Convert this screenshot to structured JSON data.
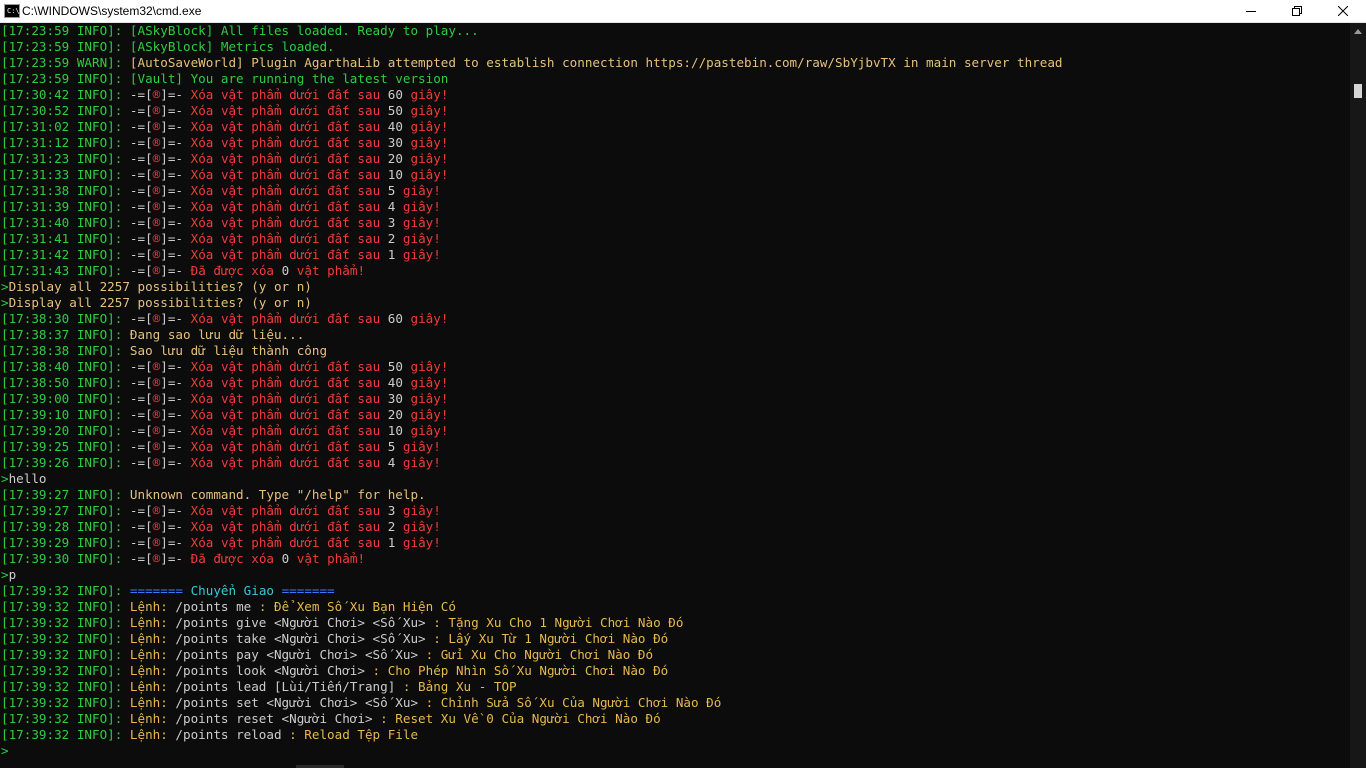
{
  "window": {
    "title": "C:\\WINDOWS\\system32\\cmd.exe",
    "icon": "cmd-icon",
    "icon_text": "C:\\",
    "controls": [
      "minimize-icon",
      "restore-icon",
      "close-icon"
    ]
  },
  "colors": {
    "timestamp": "#2ecc40",
    "message_green": "#2ecc40",
    "message_red": "#ef3b3b",
    "message_white": "#cccccc",
    "message_yellow": "#e5c07b",
    "message_cyan": "#3bc7d6",
    "background": "#0c0c0c"
  },
  "console": {
    "lines": [
      {
        "ts": "[17:23:59 INFO]:",
        "parts": [
          {
            "t": " [ASkyBlock] All files loaded. Ready to play...",
            "c": "green"
          }
        ]
      },
      {
        "ts": "[17:23:59 INFO]:",
        "parts": [
          {
            "t": " [ASkyBlock] Metrics loaded.",
            "c": "green"
          }
        ]
      },
      {
        "ts": "[17:23:59 WARN]:",
        "parts": [
          {
            "t": " [AutoSaveWorld] Plugin AgarthaLib attempted to establish connection https://pastebin.com/raw/SbYjbvTX in main server thread",
            "c": "yellow"
          }
        ]
      },
      {
        "ts": "[17:23:59 INFO]:",
        "parts": [
          {
            "t": " [Vault] You are running the latest version",
            "c": "green"
          }
        ]
      },
      {
        "ts": "[17:30:42 INFO]:",
        "parts": [
          {
            "t": " -=[",
            "c": "white"
          },
          {
            "t": "®",
            "c": "red"
          },
          {
            "t": "]=- ",
            "c": "white"
          },
          {
            "t": "Xóa vật phẩm dưới đất sau ",
            "c": "red"
          },
          {
            "t": "60",
            "c": "white"
          },
          {
            "t": " giây!",
            "c": "red"
          }
        ]
      },
      {
        "ts": "[17:30:52 INFO]:",
        "parts": [
          {
            "t": " -=[",
            "c": "white"
          },
          {
            "t": "®",
            "c": "red"
          },
          {
            "t": "]=- ",
            "c": "white"
          },
          {
            "t": "Xóa vật phẩm dưới đất sau ",
            "c": "red"
          },
          {
            "t": "50",
            "c": "white"
          },
          {
            "t": " giây!",
            "c": "red"
          }
        ]
      },
      {
        "ts": "[17:31:02 INFO]:",
        "parts": [
          {
            "t": " -=[",
            "c": "white"
          },
          {
            "t": "®",
            "c": "red"
          },
          {
            "t": "]=- ",
            "c": "white"
          },
          {
            "t": "Xóa vật phẩm dưới đất sau ",
            "c": "red"
          },
          {
            "t": "40",
            "c": "white"
          },
          {
            "t": " giây!",
            "c": "red"
          }
        ]
      },
      {
        "ts": "[17:31:12 INFO]:",
        "parts": [
          {
            "t": " -=[",
            "c": "white"
          },
          {
            "t": "®",
            "c": "red"
          },
          {
            "t": "]=- ",
            "c": "white"
          },
          {
            "t": "Xóa vật phẩm dưới đất sau ",
            "c": "red"
          },
          {
            "t": "30",
            "c": "white"
          },
          {
            "t": " giây!",
            "c": "red"
          }
        ]
      },
      {
        "ts": "[17:31:23 INFO]:",
        "parts": [
          {
            "t": " -=[",
            "c": "white"
          },
          {
            "t": "®",
            "c": "red"
          },
          {
            "t": "]=- ",
            "c": "white"
          },
          {
            "t": "Xóa vật phẩm dưới đất sau ",
            "c": "red"
          },
          {
            "t": "20",
            "c": "white"
          },
          {
            "t": " giây!",
            "c": "red"
          }
        ]
      },
      {
        "ts": "[17:31:33 INFO]:",
        "parts": [
          {
            "t": " -=[",
            "c": "white"
          },
          {
            "t": "®",
            "c": "red"
          },
          {
            "t": "]=- ",
            "c": "white"
          },
          {
            "t": "Xóa vật phẩm dưới đất sau ",
            "c": "red"
          },
          {
            "t": "10",
            "c": "white"
          },
          {
            "t": " giây!",
            "c": "red"
          }
        ]
      },
      {
        "ts": "[17:31:38 INFO]:",
        "parts": [
          {
            "t": " -=[",
            "c": "white"
          },
          {
            "t": "®",
            "c": "red"
          },
          {
            "t": "]=- ",
            "c": "white"
          },
          {
            "t": "Xóa vật phẩm dưới đất sau ",
            "c": "red"
          },
          {
            "t": "5",
            "c": "white"
          },
          {
            "t": " giây!",
            "c": "red"
          }
        ]
      },
      {
        "ts": "[17:31:39 INFO]:",
        "parts": [
          {
            "t": " -=[",
            "c": "white"
          },
          {
            "t": "®",
            "c": "red"
          },
          {
            "t": "]=- ",
            "c": "white"
          },
          {
            "t": "Xóa vật phẩm dưới đất sau ",
            "c": "red"
          },
          {
            "t": "4",
            "c": "white"
          },
          {
            "t": " giây!",
            "c": "red"
          }
        ]
      },
      {
        "ts": "[17:31:40 INFO]:",
        "parts": [
          {
            "t": " -=[",
            "c": "white"
          },
          {
            "t": "®",
            "c": "red"
          },
          {
            "t": "]=- ",
            "c": "white"
          },
          {
            "t": "Xóa vật phẩm dưới đất sau ",
            "c": "red"
          },
          {
            "t": "3",
            "c": "white"
          },
          {
            "t": " giây!",
            "c": "red"
          }
        ]
      },
      {
        "ts": "[17:31:41 INFO]:",
        "parts": [
          {
            "t": " -=[",
            "c": "white"
          },
          {
            "t": "®",
            "c": "red"
          },
          {
            "t": "]=- ",
            "c": "white"
          },
          {
            "t": "Xóa vật phẩm dưới đất sau ",
            "c": "red"
          },
          {
            "t": "2",
            "c": "white"
          },
          {
            "t": " giây!",
            "c": "red"
          }
        ]
      },
      {
        "ts": "[17:31:42 INFO]:",
        "parts": [
          {
            "t": " -=[",
            "c": "white"
          },
          {
            "t": "®",
            "c": "red"
          },
          {
            "t": "]=- ",
            "c": "white"
          },
          {
            "t": "Xóa vật phẩm dưới đất sau ",
            "c": "red"
          },
          {
            "t": "1",
            "c": "white"
          },
          {
            "t": " giây!",
            "c": "red"
          }
        ]
      },
      {
        "ts": "[17:31:43 INFO]:",
        "parts": [
          {
            "t": " -=[",
            "c": "white"
          },
          {
            "t": "®",
            "c": "red"
          },
          {
            "t": "]=- ",
            "c": "white"
          },
          {
            "t": "Đã được xóa ",
            "c": "red"
          },
          {
            "t": "0",
            "c": "white"
          },
          {
            "t": " vật phẩm!",
            "c": "red"
          }
        ]
      },
      {
        "ts": "",
        "parts": [
          {
            "t": ">",
            "c": "green"
          },
          {
            "t": "Display all 2257 possibilities? (y or n)",
            "c": "yellow"
          }
        ]
      },
      {
        "ts": "",
        "parts": [
          {
            "t": ">",
            "c": "green"
          },
          {
            "t": "Display all 2257 possibilities? (y or n)",
            "c": "yellow"
          }
        ]
      },
      {
        "ts": "[17:38:30 INFO]:",
        "parts": [
          {
            "t": " -=[",
            "c": "white"
          },
          {
            "t": "®",
            "c": "red"
          },
          {
            "t": "]=- ",
            "c": "white"
          },
          {
            "t": "Xóa vật phẩm dưới đất sau ",
            "c": "red"
          },
          {
            "t": "60",
            "c": "white"
          },
          {
            "t": " giây!",
            "c": "red"
          }
        ]
      },
      {
        "ts": "[17:38:37 INFO]:",
        "parts": [
          {
            "t": " Đang sao lưu dữ liệu...",
            "c": "yellow"
          }
        ]
      },
      {
        "ts": "[17:38:38 INFO]:",
        "parts": [
          {
            "t": " Sao lưu dữ liệu thành công",
            "c": "yellow"
          }
        ]
      },
      {
        "ts": "[17:38:40 INFO]:",
        "parts": [
          {
            "t": " -=[",
            "c": "white"
          },
          {
            "t": "®",
            "c": "red"
          },
          {
            "t": "]=- ",
            "c": "white"
          },
          {
            "t": "Xóa vật phẩm dưới đất sau ",
            "c": "red"
          },
          {
            "t": "50",
            "c": "white"
          },
          {
            "t": " giây!",
            "c": "red"
          }
        ]
      },
      {
        "ts": "[17:38:50 INFO]:",
        "parts": [
          {
            "t": " -=[",
            "c": "white"
          },
          {
            "t": "®",
            "c": "red"
          },
          {
            "t": "]=- ",
            "c": "white"
          },
          {
            "t": "Xóa vật phẩm dưới đất sau ",
            "c": "red"
          },
          {
            "t": "40",
            "c": "white"
          },
          {
            "t": " giây!",
            "c": "red"
          }
        ]
      },
      {
        "ts": "[17:39:00 INFO]:",
        "parts": [
          {
            "t": " -=[",
            "c": "white"
          },
          {
            "t": "®",
            "c": "red"
          },
          {
            "t": "]=- ",
            "c": "white"
          },
          {
            "t": "Xóa vật phẩm dưới đất sau ",
            "c": "red"
          },
          {
            "t": "30",
            "c": "white"
          },
          {
            "t": " giây!",
            "c": "red"
          }
        ]
      },
      {
        "ts": "[17:39:10 INFO]:",
        "parts": [
          {
            "t": " -=[",
            "c": "white"
          },
          {
            "t": "®",
            "c": "red"
          },
          {
            "t": "]=- ",
            "c": "white"
          },
          {
            "t": "Xóa vật phẩm dưới đất sau ",
            "c": "red"
          },
          {
            "t": "20",
            "c": "white"
          },
          {
            "t": " giây!",
            "c": "red"
          }
        ]
      },
      {
        "ts": "[17:39:20 INFO]:",
        "parts": [
          {
            "t": " -=[",
            "c": "white"
          },
          {
            "t": "®",
            "c": "red"
          },
          {
            "t": "]=- ",
            "c": "white"
          },
          {
            "t": "Xóa vật phẩm dưới đất sau ",
            "c": "red"
          },
          {
            "t": "10",
            "c": "white"
          },
          {
            "t": " giây!",
            "c": "red"
          }
        ]
      },
      {
        "ts": "[17:39:25 INFO]:",
        "parts": [
          {
            "t": " -=[",
            "c": "white"
          },
          {
            "t": "®",
            "c": "red"
          },
          {
            "t": "]=- ",
            "c": "white"
          },
          {
            "t": "Xóa vật phẩm dưới đất sau ",
            "c": "red"
          },
          {
            "t": "5",
            "c": "white"
          },
          {
            "t": " giây!",
            "c": "red"
          }
        ]
      },
      {
        "ts": "[17:39:26 INFO]:",
        "parts": [
          {
            "t": " -=[",
            "c": "white"
          },
          {
            "t": "®",
            "c": "red"
          },
          {
            "t": "]=- ",
            "c": "white"
          },
          {
            "t": "Xóa vật phẩm dưới đất sau ",
            "c": "red"
          },
          {
            "t": "4",
            "c": "white"
          },
          {
            "t": " giây!",
            "c": "red"
          }
        ]
      },
      {
        "ts": "",
        "parts": [
          {
            "t": ">",
            "c": "green"
          },
          {
            "t": "hello",
            "c": "white"
          }
        ]
      },
      {
        "ts": "[17:39:27 INFO]:",
        "parts": [
          {
            "t": " Unknown command. Type \"/help\" for help.",
            "c": "yellow"
          }
        ]
      },
      {
        "ts": "[17:39:27 INFO]:",
        "parts": [
          {
            "t": " -=[",
            "c": "white"
          },
          {
            "t": "®",
            "c": "red"
          },
          {
            "t": "]=- ",
            "c": "white"
          },
          {
            "t": "Xóa vật phẩm dưới đất sau ",
            "c": "red"
          },
          {
            "t": "3",
            "c": "white"
          },
          {
            "t": " giây!",
            "c": "red"
          }
        ]
      },
      {
        "ts": "[17:39:28 INFO]:",
        "parts": [
          {
            "t": " -=[",
            "c": "white"
          },
          {
            "t": "®",
            "c": "red"
          },
          {
            "t": "]=- ",
            "c": "white"
          },
          {
            "t": "Xóa vật phẩm dưới đất sau ",
            "c": "red"
          },
          {
            "t": "2",
            "c": "white"
          },
          {
            "t": " giây!",
            "c": "red"
          }
        ]
      },
      {
        "ts": "[17:39:29 INFO]:",
        "parts": [
          {
            "t": " -=[",
            "c": "white"
          },
          {
            "t": "®",
            "c": "red"
          },
          {
            "t": "]=- ",
            "c": "white"
          },
          {
            "t": "Xóa vật phẩm dưới đất sau ",
            "c": "red"
          },
          {
            "t": "1",
            "c": "white"
          },
          {
            "t": " giây!",
            "c": "red"
          }
        ]
      },
      {
        "ts": "[17:39:30 INFO]:",
        "parts": [
          {
            "t": " -=[",
            "c": "white"
          },
          {
            "t": "®",
            "c": "red"
          },
          {
            "t": "]=- ",
            "c": "white"
          },
          {
            "t": "Đã được xóa ",
            "c": "red"
          },
          {
            "t": "0",
            "c": "white"
          },
          {
            "t": " vật phẩm!",
            "c": "red"
          }
        ]
      },
      {
        "ts": "",
        "parts": [
          {
            "t": ">",
            "c": "green"
          },
          {
            "t": "p",
            "c": "white"
          }
        ]
      },
      {
        "ts": "[17:39:32 INFO]:",
        "parts": [
          {
            "t": " ======= ",
            "c": "blue"
          },
          {
            "t": "Chuyển Giao",
            "c": "cyan"
          },
          {
            "t": " =======",
            "c": "blue"
          }
        ]
      },
      {
        "ts": "[17:39:32 INFO]:",
        "parts": [
          {
            "t": " Lệnh: ",
            "c": "gold"
          },
          {
            "t": "/points me",
            "c": "white"
          },
          {
            "t": " : Để Xem Số Xu Bạn Hiện Có",
            "c": "gold"
          }
        ]
      },
      {
        "ts": "[17:39:32 INFO]:",
        "parts": [
          {
            "t": " Lệnh: ",
            "c": "gold"
          },
          {
            "t": "/points give <Người Chơi> <Số Xu>",
            "c": "white"
          },
          {
            "t": " : Tặng Xu Cho 1 Người Chơi Nào Đó",
            "c": "gold"
          }
        ]
      },
      {
        "ts": "[17:39:32 INFO]:",
        "parts": [
          {
            "t": " Lệnh: ",
            "c": "gold"
          },
          {
            "t": "/points take <Người Chơi> <Số Xu>",
            "c": "white"
          },
          {
            "t": " : Lấy Xu Từ 1 Người Chơi Nào Đó",
            "c": "gold"
          }
        ]
      },
      {
        "ts": "[17:39:32 INFO]:",
        "parts": [
          {
            "t": " Lệnh: ",
            "c": "gold"
          },
          {
            "t": "/points pay <Người Chơi> <Số Xu>",
            "c": "white"
          },
          {
            "t": " : Gửi Xu Cho Người Chơi Nào Đó",
            "c": "gold"
          }
        ]
      },
      {
        "ts": "[17:39:32 INFO]:",
        "parts": [
          {
            "t": " Lệnh: ",
            "c": "gold"
          },
          {
            "t": "/points look <Người Chơi>",
            "c": "white"
          },
          {
            "t": " : Cho Phép Nhìn Số Xu Người Chơi Nào Đó",
            "c": "gold"
          }
        ]
      },
      {
        "ts": "[17:39:32 INFO]:",
        "parts": [
          {
            "t": " Lệnh: ",
            "c": "gold"
          },
          {
            "t": "/points lead [Lùi/Tiến/Trang]",
            "c": "white"
          },
          {
            "t": " : Bảng Xu - TOP",
            "c": "gold"
          }
        ]
      },
      {
        "ts": "[17:39:32 INFO]:",
        "parts": [
          {
            "t": " Lệnh: ",
            "c": "gold"
          },
          {
            "t": "/points set <Người Chơi> <Số Xu>",
            "c": "white"
          },
          {
            "t": " : Chỉnh Sửa Số Xu Của Người Chơi Nào Đó",
            "c": "gold"
          }
        ]
      },
      {
        "ts": "[17:39:32 INFO]:",
        "parts": [
          {
            "t": " Lệnh: ",
            "c": "gold"
          },
          {
            "t": "/points reset <Người Chơi>",
            "c": "white"
          },
          {
            "t": " : Reset Xu Về 0 Của Người Chơi Nào Đó",
            "c": "gold"
          }
        ]
      },
      {
        "ts": "[17:39:32 INFO]:",
        "parts": [
          {
            "t": " Lệnh: ",
            "c": "gold"
          },
          {
            "t": "/points reload",
            "c": "white"
          },
          {
            "t": " : Reload Tệp File",
            "c": "gold"
          }
        ]
      },
      {
        "ts": "",
        "parts": [
          {
            "t": ">",
            "c": "green"
          }
        ]
      }
    ]
  },
  "scrollbar": {
    "up_icon": "scroll-up-arrow-icon",
    "position_fraction": 0.05
  }
}
